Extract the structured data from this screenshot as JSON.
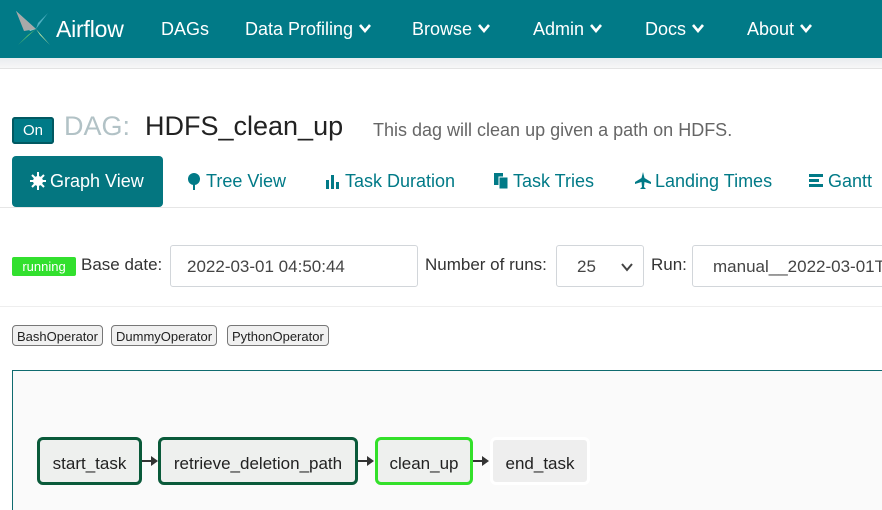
{
  "navbar": {
    "brand": "Airflow",
    "items": [
      {
        "label": "DAGs",
        "dropdown": false
      },
      {
        "label": "Data Profiling",
        "dropdown": true
      },
      {
        "label": "Browse",
        "dropdown": true
      },
      {
        "label": "Admin",
        "dropdown": true
      },
      {
        "label": "Docs",
        "dropdown": true
      },
      {
        "label": "About",
        "dropdown": true
      }
    ],
    "color": "#017a87"
  },
  "header": {
    "toggle": "On",
    "dag_prefix": "DAG:",
    "dag_id": "HDFS_clean_up",
    "description": "This dag will clean up given a path on HDFS."
  },
  "tabs": [
    {
      "label": "Graph View",
      "icon": "flash-icon",
      "active": true
    },
    {
      "label": "Tree View",
      "icon": "tree-icon",
      "active": false
    },
    {
      "label": "Task Duration",
      "icon": "bar-chart-icon",
      "active": false
    },
    {
      "label": "Task Tries",
      "icon": "duplicate-icon",
      "active": false
    },
    {
      "label": "Landing Times",
      "icon": "plane-icon",
      "active": false
    },
    {
      "label": "Gantt",
      "icon": "align-left-icon",
      "active": false
    }
  ],
  "form": {
    "state_badge": "running",
    "base_date_label": "Base date:",
    "base_date_value": "2022-03-01 04:50:44",
    "num_runs_label": "Number of runs:",
    "num_runs_value": "25",
    "run_label": "Run:",
    "run_value": "manual__2022-03-01T"
  },
  "operators": [
    "BashOperator",
    "DummyOperator",
    "PythonOperator"
  ],
  "graph": {
    "nodes": [
      {
        "label": "start_task",
        "state": "success"
      },
      {
        "label": "retrieve_deletion_path",
        "state": "success"
      },
      {
        "label": "clean_up",
        "state": "running"
      },
      {
        "label": "end_task",
        "state": "none"
      }
    ],
    "colors": {
      "success": "#0a5a3a",
      "running": "#33e02a",
      "none": "#ffffff"
    }
  }
}
